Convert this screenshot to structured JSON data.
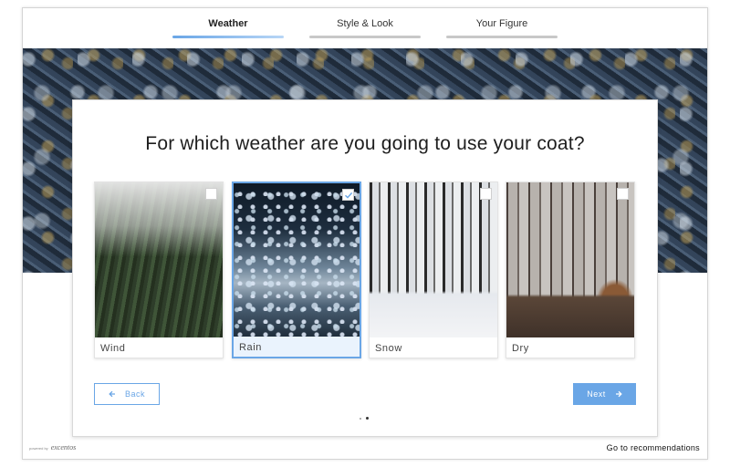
{
  "steps": [
    {
      "label": "Weather",
      "active": true
    },
    {
      "label": "Style & Look",
      "active": false
    },
    {
      "label": "Your Figure",
      "active": false
    }
  ],
  "question": "For which weather are you going to use your coat?",
  "options": [
    {
      "label": "Wind",
      "selected": false
    },
    {
      "label": "Rain",
      "selected": true
    },
    {
      "label": "Snow",
      "selected": false
    },
    {
      "label": "Dry",
      "selected": false
    }
  ],
  "buttons": {
    "back": "Back",
    "next": "Next"
  },
  "pagination": {
    "current": 2,
    "total": 2
  },
  "footer": {
    "powered_by": "powered by",
    "brand": "excentos",
    "goto_link": "Go to recommendations"
  },
  "colors": {
    "accent": "#6aa6e6"
  }
}
